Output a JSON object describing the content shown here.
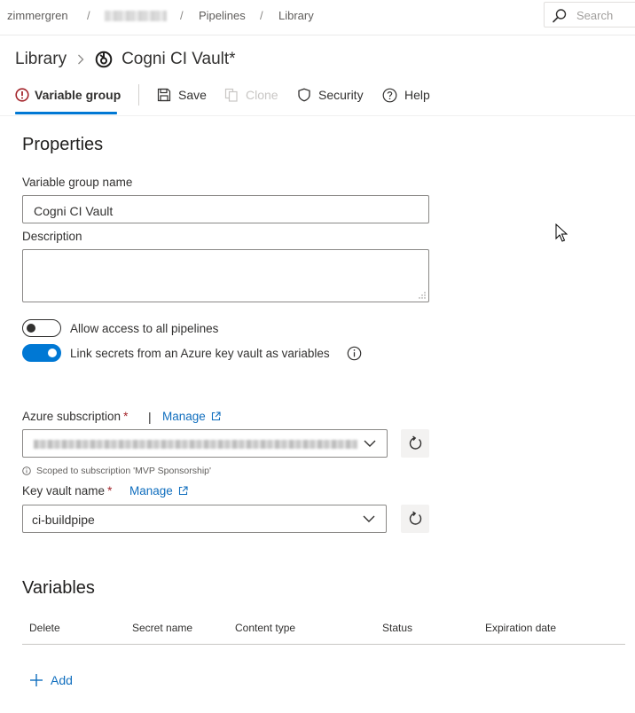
{
  "breadcrumb": {
    "org": "zimmergren",
    "separator": "/",
    "pipelines": "Pipelines",
    "library": "Library"
  },
  "search": {
    "placeholder": "Search"
  },
  "title": {
    "library": "Library",
    "group_name": "Cogni CI Vault*"
  },
  "toolbar": {
    "tab_label": "Variable group",
    "save": "Save",
    "clone": "Clone",
    "security": "Security",
    "help": "Help"
  },
  "properties": {
    "heading": "Properties",
    "name_label": "Variable group name",
    "name_value": "Cogni CI Vault",
    "description_label": "Description",
    "description_value": "",
    "toggle_all_pipelines": {
      "label": "Allow access to all pipelines",
      "on": false
    },
    "toggle_link_secrets": {
      "label": "Link secrets from an Azure key vault as variables",
      "on": true
    }
  },
  "azure": {
    "subscription_label": "Azure subscription",
    "required_mark": "*",
    "pipe": "|",
    "manage": "Manage",
    "scope_hint": "Scoped to subscription 'MVP Sponsorship'",
    "keyvault_label": "Key vault name",
    "keyvault_value": "ci-buildpipe"
  },
  "variables": {
    "heading": "Variables",
    "columns": [
      "Delete",
      "Secret name",
      "Content type",
      "Status",
      "Expiration date"
    ],
    "add": "Add"
  },
  "colors": {
    "accent": "#0078d4",
    "link": "#106ebe",
    "error": "#a4262c"
  }
}
